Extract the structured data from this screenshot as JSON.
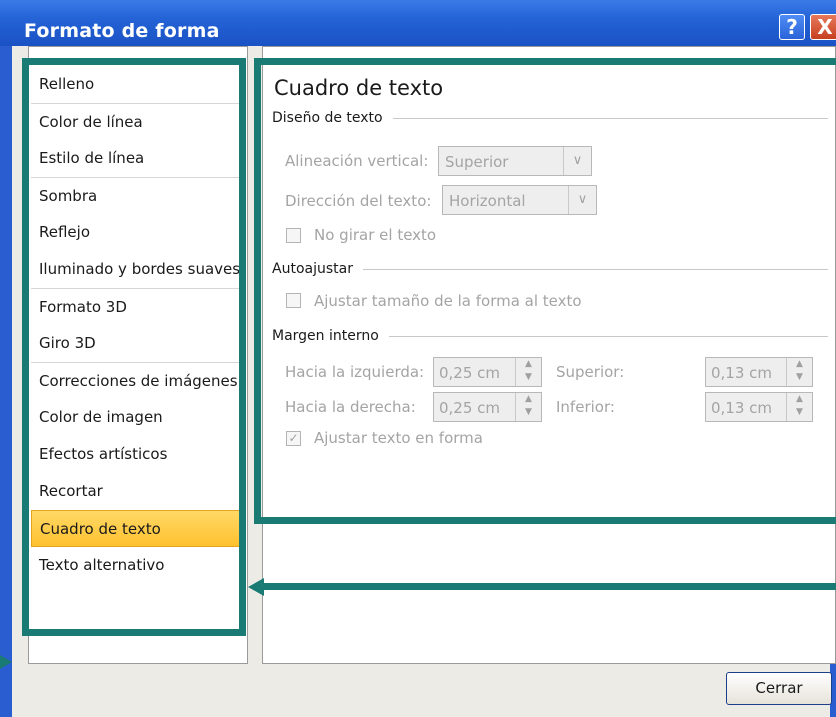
{
  "window": {
    "title": "Formato de forma",
    "help_label": "?",
    "close_label": "X"
  },
  "sidebar": {
    "items": [
      {
        "label": "Relleno",
        "sep": false
      },
      {
        "label": "Color de línea",
        "sep": true
      },
      {
        "label": "Estilo de línea",
        "sep": false
      },
      {
        "label": "Sombra",
        "sep": true
      },
      {
        "label": "Reflejo",
        "sep": false
      },
      {
        "label": "Iluminado y bordes suaves",
        "sep": false
      },
      {
        "label": "Formato 3D",
        "sep": true
      },
      {
        "label": "Giro 3D",
        "sep": false
      },
      {
        "label": "Correcciones de imágenes",
        "sep": true
      },
      {
        "label": "Color de imagen",
        "sep": false
      },
      {
        "label": "Efectos artísticos",
        "sep": false
      },
      {
        "label": "Recortar",
        "sep": false
      },
      {
        "label": "Cuadro de texto",
        "sep": false,
        "selected": true
      },
      {
        "label": "Texto alternativo",
        "sep": false
      }
    ]
  },
  "panel": {
    "title": "Cuadro de texto",
    "layout": {
      "heading": "Diseño de texto",
      "vertical_alignment_label": "Alineación vertical:",
      "vertical_alignment_value": "Superior",
      "text_direction_label": "Dirección del texto:",
      "text_direction_value": "Horizontal",
      "no_rotate_label": "No girar el texto",
      "no_rotate_checked": false
    },
    "autofit": {
      "heading": "Autoajustar",
      "resize_label": "Ajustar tamaño de la forma al texto",
      "resize_checked": false
    },
    "margins": {
      "heading": "Margen interno",
      "left_label": "Hacia la izquierda:",
      "left_value": "0,25 cm",
      "right_label": "Hacia la derecha:",
      "right_value": "0,25 cm",
      "top_label": "Superior:",
      "top_value": "0,13 cm",
      "bottom_label": "Inferior:",
      "bottom_value": "0,13 cm",
      "wrap_label": "Ajustar texto en forma",
      "wrap_checked": true
    }
  },
  "footer": {
    "close_label": "Cerrar"
  },
  "colors": {
    "highlight": "#1a7a74",
    "selected": "#ffc12f",
    "titlebar": "#2463d6"
  }
}
